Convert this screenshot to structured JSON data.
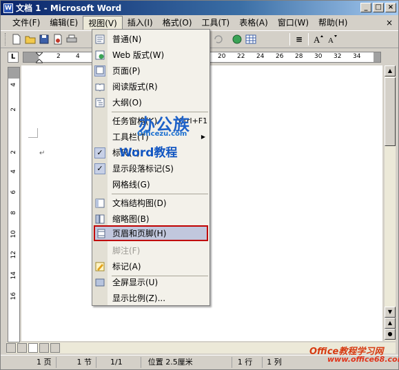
{
  "window": {
    "title": "文档 1 - Microsoft Word",
    "app_icon": "W",
    "buttons": [
      "_",
      "□",
      "×"
    ]
  },
  "menubar": {
    "items": [
      {
        "label": "文件(F)"
      },
      {
        "label": "编辑(E)"
      },
      {
        "label": "视图(V)",
        "active": true
      },
      {
        "label": "插入(I)"
      },
      {
        "label": "格式(O)"
      },
      {
        "label": "工具(T)"
      },
      {
        "label": "表格(A)"
      },
      {
        "label": "窗口(W)"
      },
      {
        "label": "帮助(H)"
      }
    ],
    "close": "×"
  },
  "toolbar": {
    "align_label": "≡"
  },
  "ruler": {
    "corner": "L",
    "ticks": [
      "2",
      "4",
      "20",
      "22",
      "24",
      "26",
      "28",
      "30",
      "32",
      "34"
    ],
    "vticks": [
      "4",
      "2",
      "2",
      "4",
      "6",
      "8",
      "10",
      "12",
      "14",
      "16"
    ]
  },
  "view_menu": {
    "items": [
      {
        "label": "普通(N)",
        "icon": "normal-view-icon"
      },
      {
        "label": "Web 版式(W)",
        "icon": "web-layout-icon"
      },
      {
        "label": "页面(P)",
        "icon": "print-layout-icon",
        "checked": true
      },
      {
        "label": "阅读版式(R)",
        "icon": "reading-layout-icon"
      },
      {
        "label": "大纲(O)",
        "icon": "outline-icon"
      },
      {
        "label": "任务窗格(K)",
        "shortcut": "Ctrl+F1"
      },
      {
        "label": "工具栏(T)",
        "submenu": true
      },
      {
        "label": "标尺(L)",
        "checked": true
      },
      {
        "label": "显示段落标记(S)",
        "checked": true
      },
      {
        "label": "网格线(G)"
      },
      {
        "label": "文档结构图(D)",
        "icon": "document-map-icon"
      },
      {
        "label": "缩略图(B)",
        "icon": "thumbnails-icon"
      },
      {
        "label": "页眉和页脚(H)",
        "icon": "header-footer-icon",
        "highlight": true
      },
      {
        "label": "脚注(F)",
        "disabled": true
      },
      {
        "label": "标记(A)",
        "icon": "markup-icon"
      },
      {
        "label": "全屏显示(U)",
        "icon": "full-screen-icon"
      },
      {
        "label": "显示比例(Z)..."
      }
    ]
  },
  "status": {
    "page": "1 页",
    "section": "1 节",
    "page_of": "1/1",
    "position": "位置 2.5厘米",
    "line": "1 行",
    "column": "1 列"
  },
  "watermark": {
    "logo": "办公族",
    "domain": "Officezu.com",
    "subtitle": "Word教程",
    "footer_logo": "Office教程学习网",
    "footer_url": "www.office68.com"
  },
  "colors": {
    "title_bar": "#0a246a",
    "highlight_border": "#c00000",
    "menu_bg": "#f3f1ea"
  }
}
